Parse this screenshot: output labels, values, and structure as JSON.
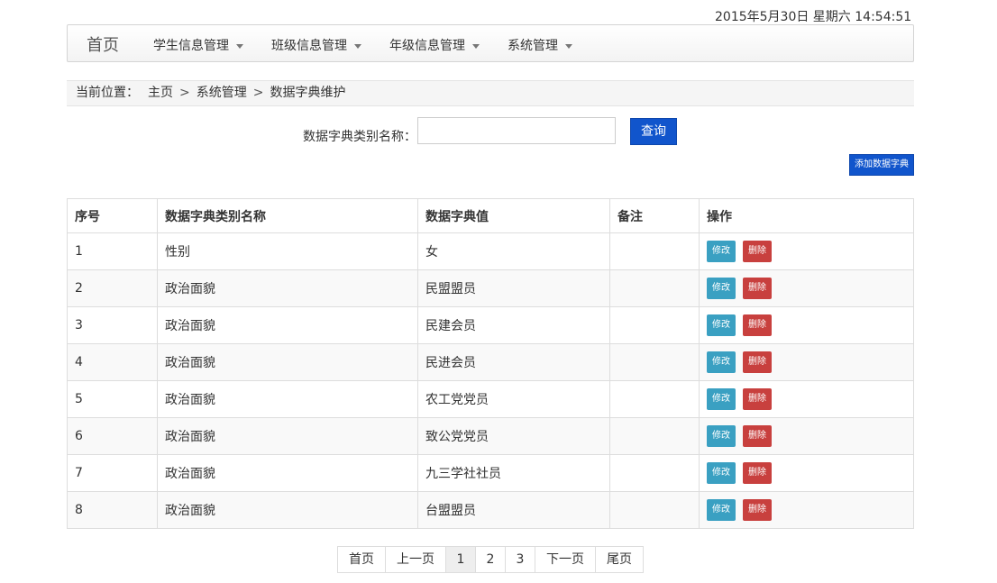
{
  "header": {
    "datetime": "2015年5月30日  星期六  14:54:51"
  },
  "navbar": {
    "brand": "首页",
    "items": [
      {
        "label": "学生信息管理"
      },
      {
        "label": "班级信息管理"
      },
      {
        "label": "年级信息管理"
      },
      {
        "label": "系统管理"
      }
    ]
  },
  "breadcrumb": {
    "label": "当前位置：",
    "items": [
      "主页",
      "系统管理",
      "数据字典维护"
    ],
    "separator": ">"
  },
  "search": {
    "label": "数据字典类别名称：",
    "value": "",
    "button": "查询"
  },
  "actions": {
    "add": "添加数据字典"
  },
  "table": {
    "headers": [
      "序号",
      "数据字典类别名称",
      "数据字典值",
      "备注",
      "操作"
    ],
    "rows": [
      {
        "no": "1",
        "type": "性别",
        "value": "女",
        "note": ""
      },
      {
        "no": "2",
        "type": "政治面貌",
        "value": "民盟盟员",
        "note": ""
      },
      {
        "no": "3",
        "type": "政治面貌",
        "value": "民建会员",
        "note": ""
      },
      {
        "no": "4",
        "type": "政治面貌",
        "value": "民进会员",
        "note": ""
      },
      {
        "no": "5",
        "type": "政治面貌",
        "value": "农工党党员",
        "note": ""
      },
      {
        "no": "6",
        "type": "政治面貌",
        "value": "致公党党员",
        "note": ""
      },
      {
        "no": "7",
        "type": "政治面貌",
        "value": "九三学社社员",
        "note": ""
      },
      {
        "no": "8",
        "type": "政治面貌",
        "value": "台盟盟员",
        "note": ""
      }
    ],
    "edit_label": "修改",
    "delete_label": "删除"
  },
  "pagination": {
    "first": "首页",
    "prev": "上一页",
    "pages": [
      "1",
      "2",
      "3"
    ],
    "current": "1",
    "next": "下一页",
    "last": "尾页"
  },
  "colors": {
    "primary": "#1155cc",
    "edit": "#3aa0c2",
    "delete": "#c8403e"
  }
}
